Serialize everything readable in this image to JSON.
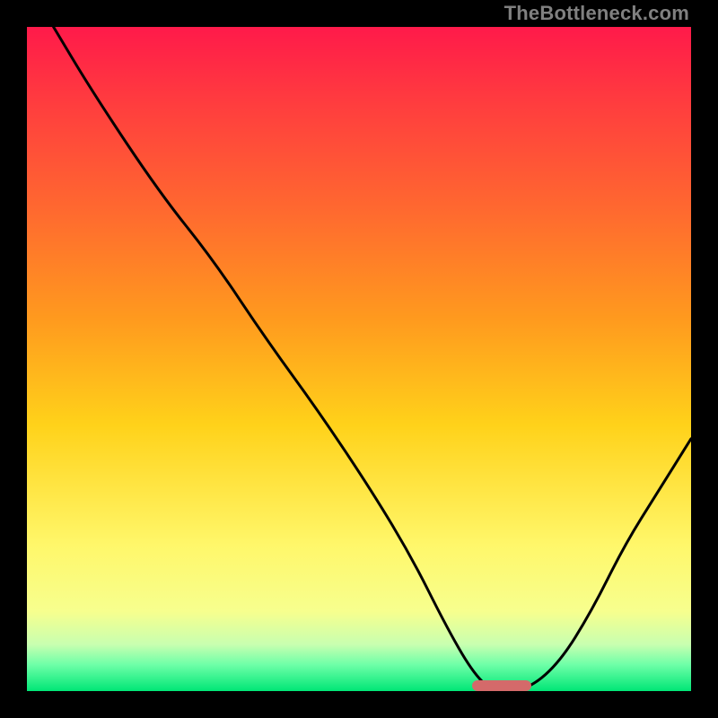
{
  "watermark": "TheBottleneck.com",
  "chart_data": {
    "type": "line",
    "title": "",
    "xlabel": "",
    "ylabel": "",
    "xlim": [
      0,
      100
    ],
    "ylim": [
      0,
      100
    ],
    "grid": false,
    "legend": false,
    "background_gradient_vertical": [
      {
        "pct": 0,
        "color": "#ff1a4a"
      },
      {
        "pct": 12,
        "color": "#ff3e3e"
      },
      {
        "pct": 28,
        "color": "#ff6a2f"
      },
      {
        "pct": 44,
        "color": "#ff9a1e"
      },
      {
        "pct": 60,
        "color": "#ffd21a"
      },
      {
        "pct": 78,
        "color": "#fff76a"
      },
      {
        "pct": 88,
        "color": "#f7ff8e"
      },
      {
        "pct": 93,
        "color": "#c8ffb0"
      },
      {
        "pct": 96,
        "color": "#6fffa8"
      },
      {
        "pct": 100,
        "color": "#00e676"
      }
    ],
    "series": [
      {
        "name": "bottleneck-curve",
        "stroke": "#000000",
        "stroke_width": 3,
        "x": [
          4,
          10,
          20,
          28,
          36,
          44,
          52,
          58,
          63,
          67,
          70,
          75,
          80,
          85,
          90,
          95,
          100
        ],
        "y": [
          100,
          90,
          75,
          65,
          53,
          42,
          30,
          20,
          10,
          3,
          0,
          0,
          4,
          12,
          22,
          30,
          38
        ]
      }
    ],
    "marker": {
      "name": "bottleneck-min-marker",
      "color": "#d46a6a",
      "x_start": 67,
      "x_end": 76,
      "y": 0,
      "height_pct": 1.6
    }
  }
}
